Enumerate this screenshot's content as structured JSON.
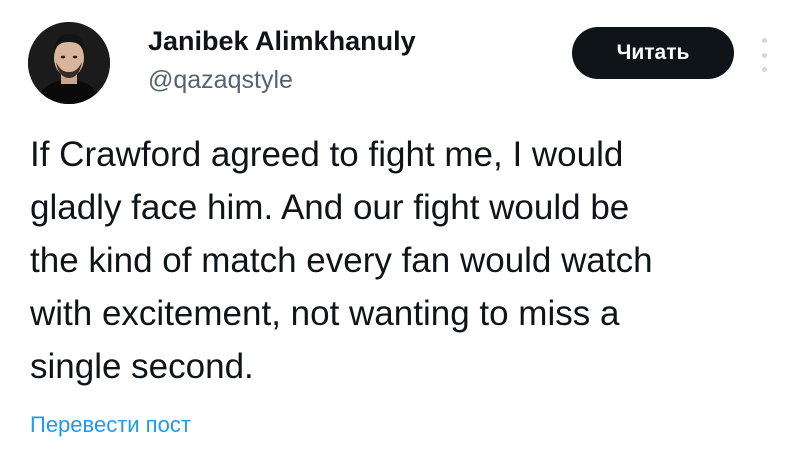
{
  "author": {
    "name": "Janibek Alimkhanuly",
    "handle": "@qazaqstyle"
  },
  "follow_button": {
    "label": "Читать"
  },
  "more_menu": {
    "icon": "more-vertical-icon"
  },
  "tweet": {
    "text": "If Crawford agreed to fight me, I would\ngladly face him. And our fight would be\nthe kind of match every fan would watch\nwith excitement, not wanting to miss a\nsingle second."
  },
  "translate_link": {
    "label": "Перевести пост"
  },
  "colors": {
    "text": "#0f1419",
    "secondary": "#536471",
    "link": "#1d9bf0",
    "button_bg": "#0f1419",
    "button_text": "#ffffff"
  }
}
